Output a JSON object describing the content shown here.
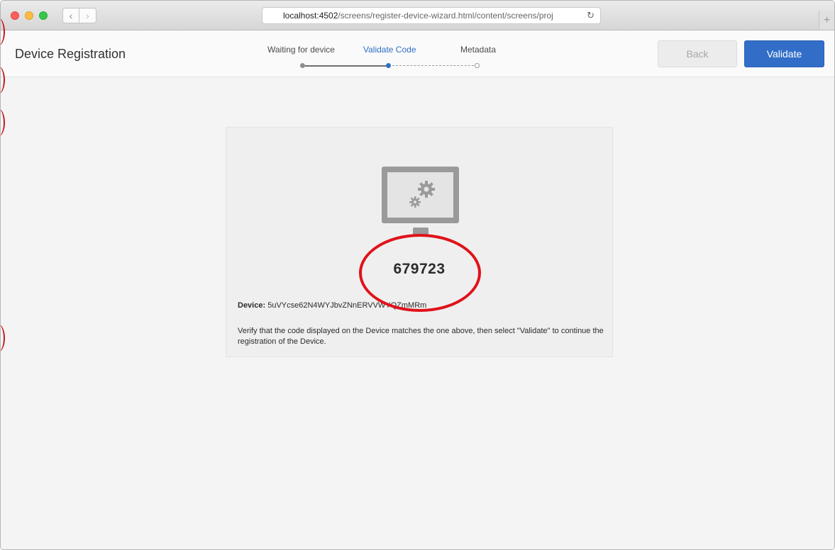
{
  "browser": {
    "url_host": "localhost:4502",
    "url_path": "/screens/register-device-wizard.html/content/screens/proj",
    "reload_icon": "reload-icon",
    "back_icon": "chevron-left-icon",
    "forward_icon": "chevron-right-icon",
    "new_tab_icon": "plus-icon"
  },
  "header": {
    "title": "Device Registration",
    "steps": [
      {
        "label": "Waiting for device",
        "state": "done"
      },
      {
        "label": "Validate Code",
        "state": "current"
      },
      {
        "label": "Metadata",
        "state": "todo"
      }
    ],
    "back_label": "Back",
    "validate_label": "Validate"
  },
  "card": {
    "illustration_icon": "monitor-gears-icon",
    "code": "679723",
    "device_label": "Device:",
    "device_id": "5uVYcse62N4WYJbvZNnERVVWYQZmMRm",
    "description": "Verify that the code displayed on the Device matches the one above, then select \"Validate\" to continue the registration of the Device."
  },
  "colors": {
    "accent": "#326ec8",
    "annotation": "#e0121a"
  }
}
